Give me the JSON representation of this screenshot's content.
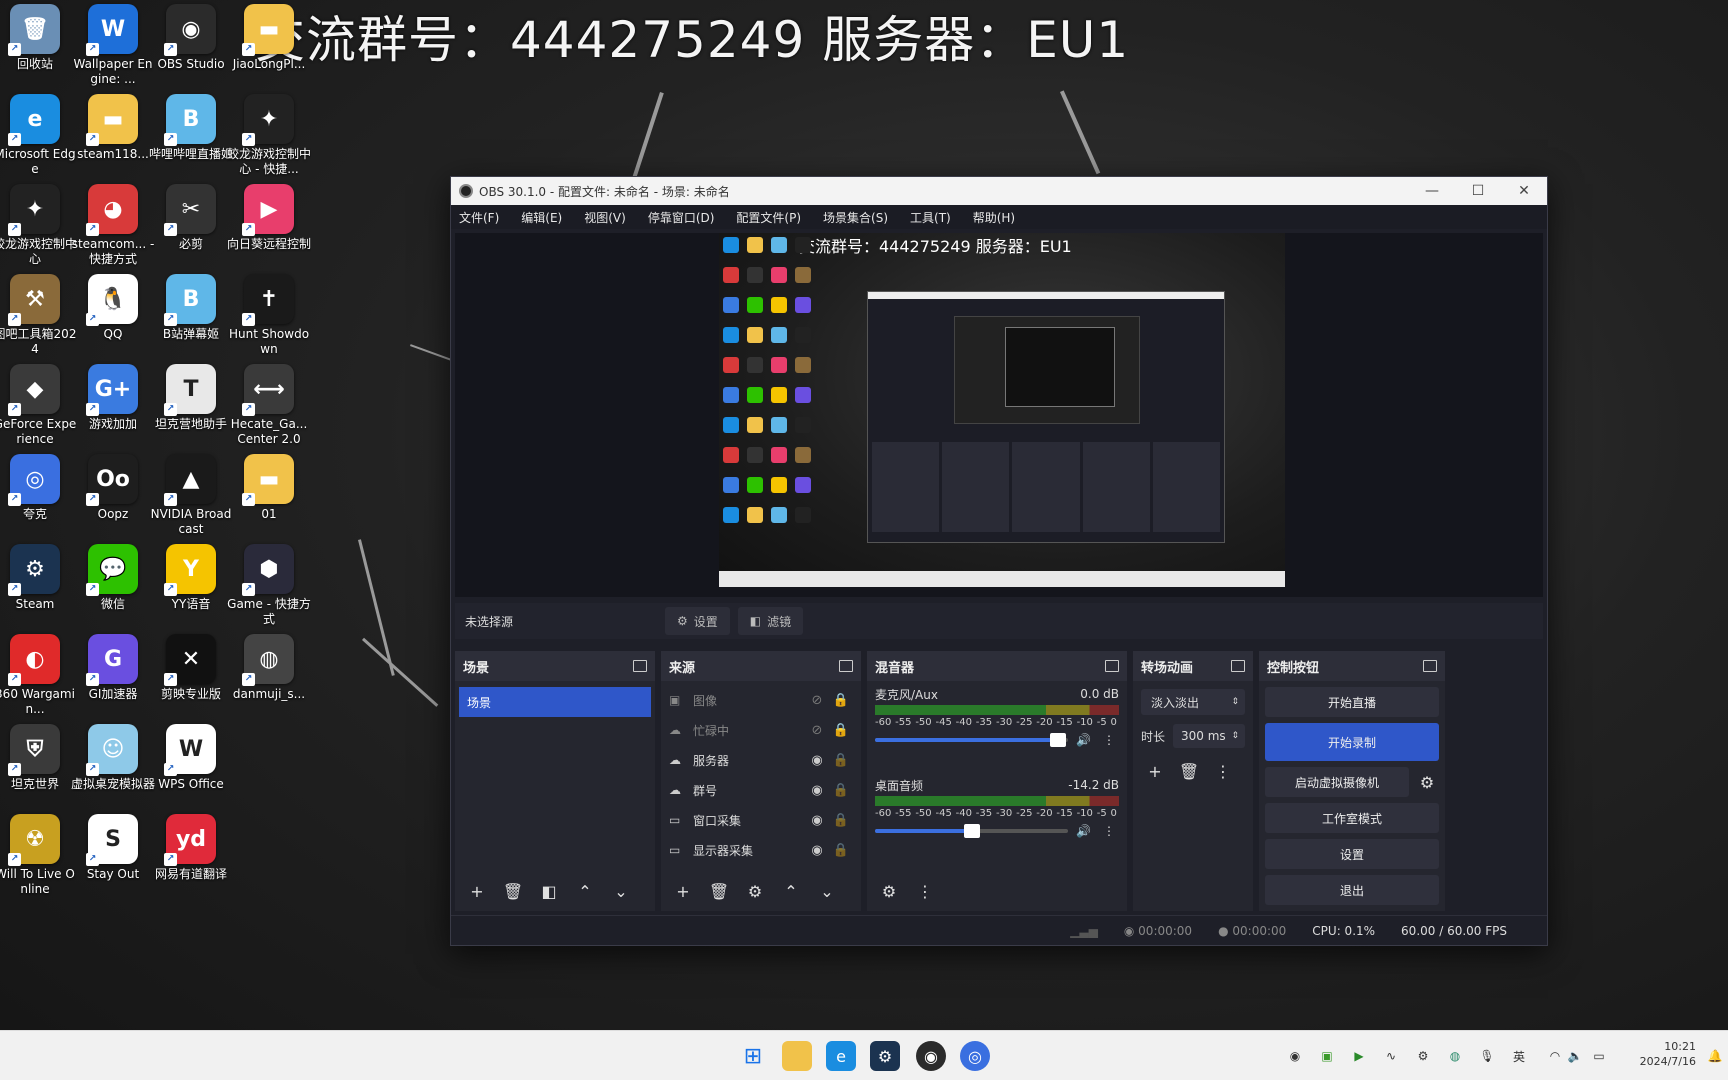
{
  "banner": {
    "text": "交流群号：444275249  服务器：EU1"
  },
  "desktop_icons": [
    {
      "label": "回收站",
      "icon": "recycle-bin-icon",
      "color": "#6a8fb5",
      "glyph": "🗑"
    },
    {
      "label": "Wallpaper Engine: ...",
      "icon": "wallpaper-engine-icon",
      "color": "#1e6fd9",
      "glyph": "W"
    },
    {
      "label": "OBS Studio",
      "icon": "obs-icon",
      "color": "#2b2b2b",
      "glyph": "◉"
    },
    {
      "label": "JiaoLongPl...",
      "icon": "folder-icon",
      "color": "#f1c24a",
      "glyph": "▬"
    },
    {
      "label": "Microsoft Edge",
      "icon": "edge-icon",
      "color": "#1a8de0",
      "glyph": "e"
    },
    {
      "label": "steam118...",
      "icon": "folder-icon",
      "color": "#f1c24a",
      "glyph": "▬"
    },
    {
      "label": "哔哩哔哩直播姬",
      "icon": "bilibili-live-icon",
      "color": "#5fb7e8",
      "glyph": "B"
    },
    {
      "label": "蛟龙游戏控制中心 - 快捷...",
      "icon": "jiaolong-icon",
      "color": "#222",
      "glyph": "✦"
    },
    {
      "label": "蛟龙游戏控制中心",
      "icon": "jiaolong-icon",
      "color": "#222",
      "glyph": "✦"
    },
    {
      "label": "steamcom... - 快捷方式",
      "icon": "steamcommunity-icon",
      "color": "#d83a3a",
      "glyph": "◕"
    },
    {
      "label": "必剪",
      "icon": "bijian-icon",
      "color": "#333",
      "glyph": "✂"
    },
    {
      "label": "向日葵远程控制",
      "icon": "sunflower-icon",
      "color": "#e83e6c",
      "glyph": "▶"
    },
    {
      "label": "图吧工具箱2024",
      "icon": "tuba-toolbox-icon",
      "color": "#8a6a3a",
      "glyph": "⚒"
    },
    {
      "label": "QQ",
      "icon": "qq-icon",
      "color": "#ffffff",
      "glyph": "🐧"
    },
    {
      "label": "B站弹幕姬",
      "icon": "bilibili-danmaku-icon",
      "color": "#5fb7e8",
      "glyph": "B"
    },
    {
      "label": "Hunt Showdown",
      "icon": "hunt-showdown-icon",
      "color": "#1a1a1a",
      "glyph": "✝"
    },
    {
      "label": "GeForce Experience",
      "icon": "geforce-icon",
      "color": "#3a3a3a",
      "glyph": "◆"
    },
    {
      "label": "游戏加加",
      "icon": "youxijiajia-icon",
      "color": "#3a7be0",
      "glyph": "G+"
    },
    {
      "label": "坦克营地助手",
      "icon": "tank-camp-icon",
      "color": "#e8e8e8",
      "glyph": "T"
    },
    {
      "label": "Hecate_Ga... Center 2.0",
      "icon": "hecate-icon",
      "color": "#3a3a3a",
      "glyph": "⟷"
    },
    {
      "label": "夸克",
      "icon": "quark-icon",
      "color": "#3a6fe0",
      "glyph": "◎"
    },
    {
      "label": "Oopz",
      "icon": "oopz-icon",
      "color": "#1e1e1e",
      "glyph": "Oo"
    },
    {
      "label": "NVIDIA Broadcast",
      "icon": "nvidia-broadcast-icon",
      "color": "#1a1a1a",
      "glyph": "▲"
    },
    {
      "label": "01",
      "icon": "folder-icon",
      "color": "#f1c24a",
      "glyph": "▬"
    },
    {
      "label": "Steam",
      "icon": "steam-icon",
      "color": "#1b3350",
      "glyph": "⚙"
    },
    {
      "label": "微信",
      "icon": "wechat-icon",
      "color": "#2dc100",
      "glyph": "💬"
    },
    {
      "label": "YY语音",
      "icon": "yy-icon",
      "color": "#f5c400",
      "glyph": "Y"
    },
    {
      "label": "Game - 快捷方式",
      "icon": "game-shortcut-icon",
      "color": "#2a2a3a",
      "glyph": "⬢"
    },
    {
      "label": "360 Wargamin...",
      "icon": "wargaming-icon",
      "color": "#e02a2a",
      "glyph": "◐"
    },
    {
      "label": "GI加速器",
      "icon": "gi-accelerator-icon",
      "color": "#6a4fe0",
      "glyph": "G"
    },
    {
      "label": "剪映专业版",
      "icon": "jianying-icon",
      "color": "#111",
      "glyph": "✕"
    },
    {
      "label": "danmuji_s...",
      "icon": "danmuji-icon",
      "color": "#444",
      "glyph": "◍"
    },
    {
      "label": "坦克世界",
      "icon": "world-of-tanks-icon",
      "color": "#3a3a3a",
      "glyph": "⛨"
    },
    {
      "label": "虚拟桌宠模拟器",
      "icon": "virtual-pet-icon",
      "color": "#8ec9e8",
      "glyph": "☺"
    },
    {
      "label": "WPS Office",
      "icon": "wps-icon",
      "color": "#ffffff",
      "glyph": "W"
    },
    {
      "label": "",
      "icon": "none",
      "color": "transparent",
      "glyph": ""
    },
    {
      "label": "Will To Live Online",
      "icon": "will-to-live-icon",
      "color": "#c8a020",
      "glyph": "☢"
    },
    {
      "label": "Stay Out",
      "icon": "stay-out-icon",
      "color": "#ffffff",
      "glyph": "S"
    },
    {
      "label": "网易有道翻译",
      "icon": "youdao-icon",
      "color": "#e02a3a",
      "glyph": "yd"
    }
  ],
  "obs": {
    "title": "OBS 30.1.0 - 配置文件: 未命名 - 场景: 未命名",
    "menu": [
      "文件(F)",
      "编辑(E)",
      "视图(V)",
      "停靠窗口(D)",
      "配置文件(P)",
      "场景集合(S)",
      "工具(T)",
      "帮助(H)"
    ],
    "preview_banner": "交流群号：444275249  服务器：EU1",
    "source_bar": {
      "no_source": "未选择源",
      "settings": "设置",
      "filters": "滤镜"
    },
    "scenes": {
      "title": "场景",
      "items": [
        "场景"
      ]
    },
    "sources": {
      "title": "来源",
      "items": [
        {
          "name": "图像",
          "icon": "image-icon",
          "glyph": "▣",
          "hidden": true,
          "locked": true
        },
        {
          "name": "忙碌中",
          "icon": "cloud-icon",
          "glyph": "☁",
          "hidden": true,
          "locked": true
        },
        {
          "name": "服务器",
          "icon": "cloud-icon",
          "glyph": "☁",
          "hidden": false,
          "locked": false
        },
        {
          "name": "群号",
          "icon": "cloud-icon",
          "glyph": "☁",
          "hidden": false,
          "locked": false
        },
        {
          "name": "窗口采集",
          "icon": "window-icon",
          "glyph": "▭",
          "hidden": false,
          "locked": false
        },
        {
          "name": "显示器采集",
          "icon": "monitor-icon",
          "glyph": "▭",
          "hidden": false,
          "locked": false
        }
      ]
    },
    "mixer": {
      "title": "混音器",
      "channels": [
        {
          "name": "麦克风/Aux",
          "db": "0.0 dB",
          "level": 0.95
        },
        {
          "name": "桌面音频",
          "db": "-14.2 dB",
          "level": 0.5
        }
      ],
      "ticks": [
        "-60",
        "-55",
        "-50",
        "-45",
        "-40",
        "-35",
        "-30",
        "-25",
        "-20",
        "-15",
        "-10",
        "-5",
        "0"
      ]
    },
    "transitions": {
      "title": "转场动画",
      "selected": "淡入淡出",
      "duration_label": "时长",
      "duration": "300 ms"
    },
    "controls": {
      "title": "控制按钮",
      "buttons": [
        "开始直播",
        "开始录制",
        "启动虚拟摄像机",
        "工作室模式",
        "设置",
        "退出"
      ]
    },
    "status": {
      "live_time": "00:00:00",
      "rec_time": "00:00:00",
      "cpu": "CPU: 0.1%",
      "fps": "60.00 / 60.00 FPS"
    }
  },
  "taskbar": {
    "clock_time": "10:21",
    "clock_date": "2024/7/16",
    "ime": "英"
  },
  "colors": {
    "accent": "#2f57c9",
    "obs_bg": "#1e1f28",
    "dock_bg": "#25262f"
  }
}
